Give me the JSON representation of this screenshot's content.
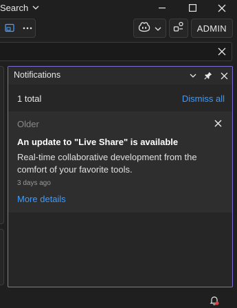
{
  "titlebar": {
    "search_label": "Search"
  },
  "toolbar": {
    "admin_label": "ADMIN"
  },
  "notifications": {
    "title": "Notifications",
    "total_text": "1 total",
    "dismiss_all_label": "Dismiss all",
    "items": [
      {
        "group_label": "Older",
        "title": "An update to \"Live Share\" is available",
        "body": "Real-time collaborative development from the comfort of your favorite tools.",
        "time": "3 days ago",
        "link_label": "More details"
      }
    ]
  },
  "colors": {
    "accent_border": "#7c6fd6",
    "link": "#3b9cff",
    "badge": "#e04040"
  }
}
